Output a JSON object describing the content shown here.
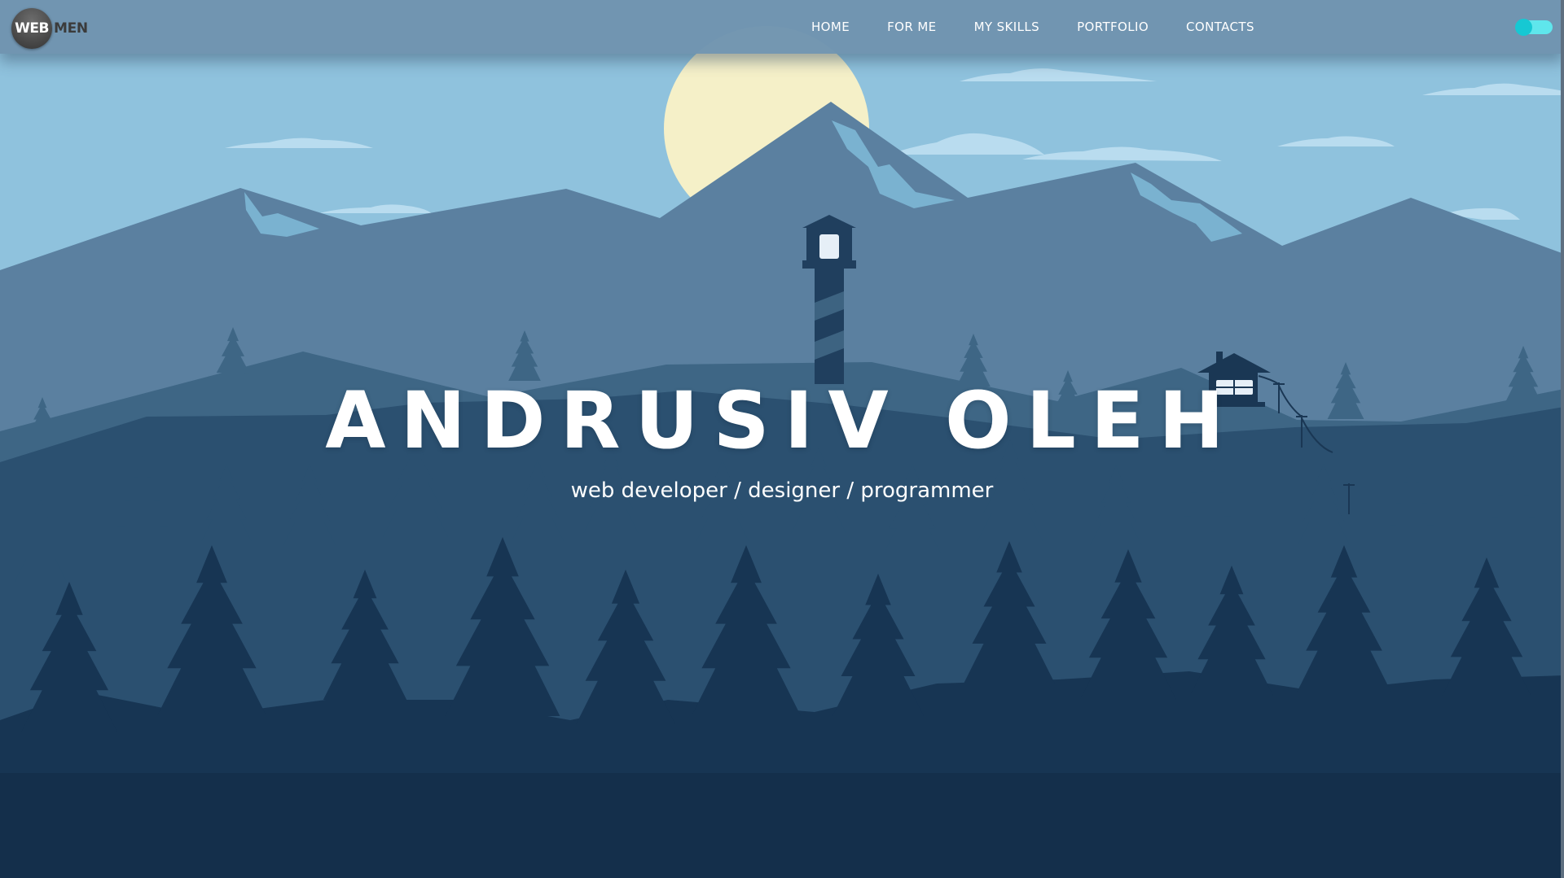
{
  "logo": {
    "part1": "WEB",
    "part2": "MEN"
  },
  "nav": {
    "items": [
      {
        "label": "HOME"
      },
      {
        "label": "FOR ME"
      },
      {
        "label": "MY SKILLS"
      },
      {
        "label": "PORTFOLIO"
      },
      {
        "label": "CONTACTS"
      }
    ]
  },
  "theme_toggle": {
    "state": "on",
    "color": "#5fe6ec"
  },
  "hero": {
    "title": "ANDRUSIV OLEH",
    "subtitle": "web developer / designer / programmer"
  },
  "colors": {
    "sky": "#8fc2dd",
    "moon": "#f5f0c8",
    "mountain_far": "#5b80a0",
    "forest_back": "#2b5070",
    "forest_front": "#173553",
    "ground": "#142f4b"
  }
}
